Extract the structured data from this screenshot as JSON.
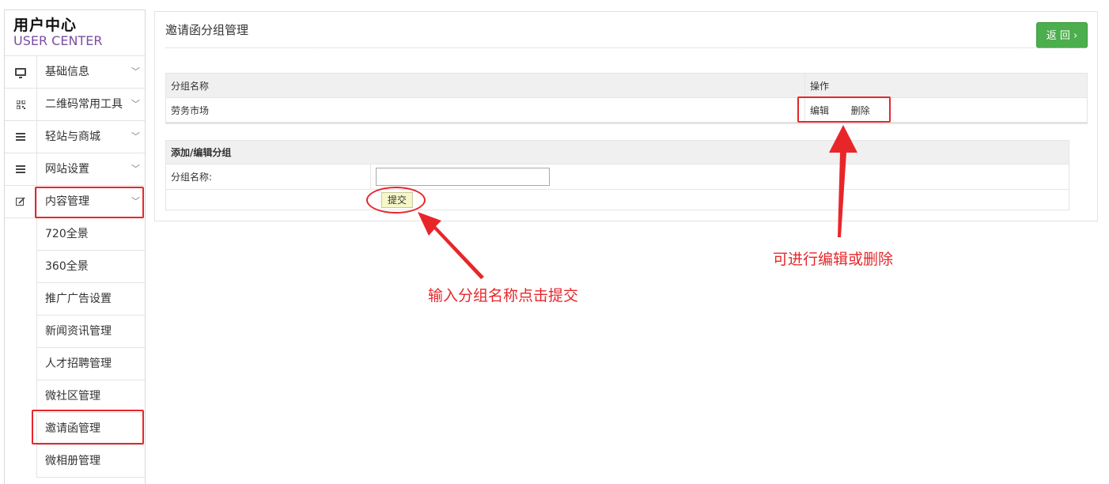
{
  "sidebar": {
    "logo_title": "用户中心",
    "logo_subtitle": "USER CENTER",
    "items": [
      {
        "label": "基础信息",
        "icon": "monitor-icon"
      },
      {
        "label": "二维码常用工具",
        "icon": "qrcode-icon"
      },
      {
        "label": "轻站与商城",
        "icon": "list-icon"
      },
      {
        "label": "网站设置",
        "icon": "list-icon"
      },
      {
        "label": "内容管理",
        "icon": "edit-icon"
      }
    ],
    "subitems": [
      {
        "label": "720全景"
      },
      {
        "label": "360全景"
      },
      {
        "label": "推广广告设置"
      },
      {
        "label": "新闻资讯管理"
      },
      {
        "label": "人才招聘管理"
      },
      {
        "label": "微社区管理"
      },
      {
        "label": "邀请函管理"
      },
      {
        "label": "微相册管理"
      }
    ]
  },
  "main": {
    "title": "邀请函分组管理",
    "back_label": "返 回 ›",
    "list": {
      "headers": [
        "分组名称",
        "操作"
      ],
      "rows": [
        {
          "name": "劳务市场",
          "edit": "编辑",
          "delete": "删除"
        }
      ]
    },
    "form": {
      "title": "添加/编辑分组",
      "field_label": "分组名称:",
      "field_value": "",
      "submit_label": "提交"
    }
  },
  "annotations": {
    "submit_hint": "输入分组名称点击提交",
    "edit_hint": "可进行编辑或删除"
  },
  "colors": {
    "highlight": "#e8262a",
    "back_button": "#4cae4c",
    "logo_subtitle": "#7a4fa0"
  }
}
